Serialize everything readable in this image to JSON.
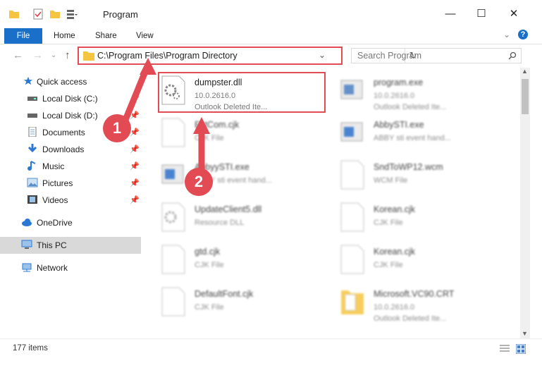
{
  "window": {
    "title": "Program",
    "minimize": "—",
    "maximize": "☐",
    "close": "✕"
  },
  "ribbon": {
    "file": "File",
    "tabs": [
      "Home",
      "Share",
      "View"
    ],
    "help": "?"
  },
  "address": {
    "path": "C:\\Program Files\\Program Directory",
    "search_placeholder": "Search Program"
  },
  "sidebar": [
    {
      "label": "Quick access",
      "icon": "star-icon",
      "pinned": false
    },
    {
      "label": "Local Disk (C:)",
      "icon": "drive-icon",
      "pinned": true
    },
    {
      "label": "Local Disk (D:)",
      "icon": "drive-icon",
      "pinned": true
    },
    {
      "label": "Documents",
      "icon": "documents-icon",
      "pinned": true
    },
    {
      "label": "Downloads",
      "icon": "downloads-icon",
      "pinned": true
    },
    {
      "label": "Music",
      "icon": "music-icon",
      "pinned": true
    },
    {
      "label": "Pictures",
      "icon": "pictures-icon",
      "pinned": true
    },
    {
      "label": "Videos",
      "icon": "videos-icon",
      "pinned": true
    },
    {
      "label": "OneDrive",
      "icon": "cloud-icon",
      "pinned": false
    },
    {
      "label": "This PC",
      "icon": "pc-icon",
      "pinned": false
    },
    {
      "label": "Network",
      "icon": "network-icon",
      "pinned": false
    }
  ],
  "files": [
    {
      "name": "dumpster.dll",
      "sub": "10.0.2616.0",
      "sub2": "Outlook Deleted Ite...",
      "icon": "dll-gear-icon"
    },
    {
      "name": "program.exe",
      "sub": "10.0.2616.0",
      "sub2": "Outlook Deleted Ite...",
      "icon": "exe-icon"
    },
    {
      "name": "ExtCom.cjk",
      "sub": "CJK File",
      "sub2": "",
      "icon": "file-icon"
    },
    {
      "name": "AbbySTI.exe",
      "sub": "ABBY sti event hand...",
      "sub2": "",
      "icon": "exe-icon"
    },
    {
      "name": "AbbyySTI.exe",
      "sub": "ABBY sti event hand...",
      "sub2": "",
      "icon": "exe-icon"
    },
    {
      "name": "SndToWP12.wcm",
      "sub": "WCM File",
      "sub2": "",
      "icon": "file-icon"
    },
    {
      "name": "UpdateClient5.dll",
      "sub": "Resource DLL",
      "sub2": "",
      "icon": "dll-gear-icon"
    },
    {
      "name": "Korean.cjk",
      "sub": "CJK File",
      "sub2": "",
      "icon": "file-icon"
    },
    {
      "name": "gtd.cjk",
      "sub": "CJK File",
      "sub2": "",
      "icon": "file-icon"
    },
    {
      "name": "Korean.cjk",
      "sub": "CJK File",
      "sub2": "",
      "icon": "file-icon"
    },
    {
      "name": "DefaultFont.cjk",
      "sub": "CJK File",
      "sub2": "",
      "icon": "file-icon"
    },
    {
      "name": "Microsoft.VC90.CRT",
      "sub": "10.0.2616.0",
      "sub2": "Outlook Deleted Ite...",
      "icon": "folder-icon"
    }
  ],
  "status": {
    "count": "177 items"
  },
  "annotations": {
    "badge1": "1",
    "badge2": "2"
  },
  "colors": {
    "accent": "#1a6fc9",
    "highlight": "#e24a54"
  }
}
